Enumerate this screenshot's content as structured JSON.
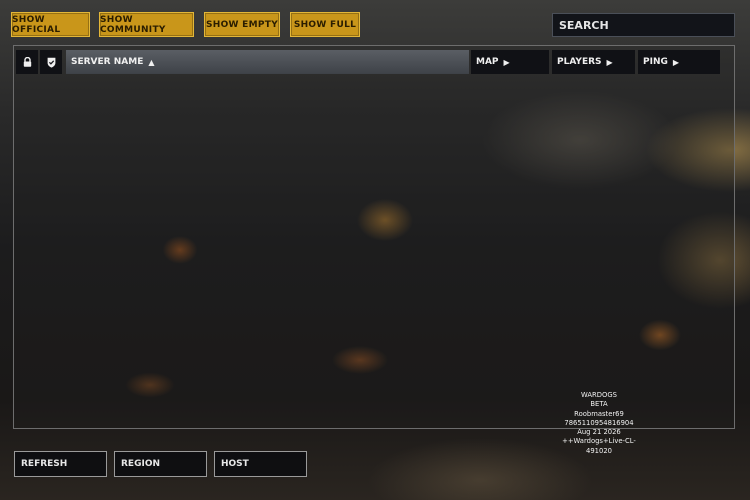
{
  "filters": {
    "official": "SHOW OFFICIAL",
    "community": "SHOW COMMUNITY",
    "empty": "SHOW EMPTY",
    "full": "SHOW FULL"
  },
  "search": {
    "placeholder": "SEARCH"
  },
  "columns": {
    "lock_icon": "lock-icon",
    "shield_icon": "shield-check-icon",
    "server_name": "SERVER NAME",
    "map": "MAP",
    "players": "PLAYERS",
    "ping": "PING"
  },
  "sort_indicator": {
    "server_name": "▲",
    "map": "▶",
    "players": "▶",
    "ping": "▶"
  },
  "server_info": [
    "WARDOGS",
    "BETA",
    "Roobmaster69",
    "7865110954816904",
    "Aug 21 2026",
    "++Wardogs+Live-CL-491020"
  ],
  "actions": {
    "refresh": "REFRESH",
    "region": "REGION",
    "host": "HOST"
  },
  "colors": {
    "accent": "#c9961a",
    "panel_dark": "#0e0f14"
  }
}
